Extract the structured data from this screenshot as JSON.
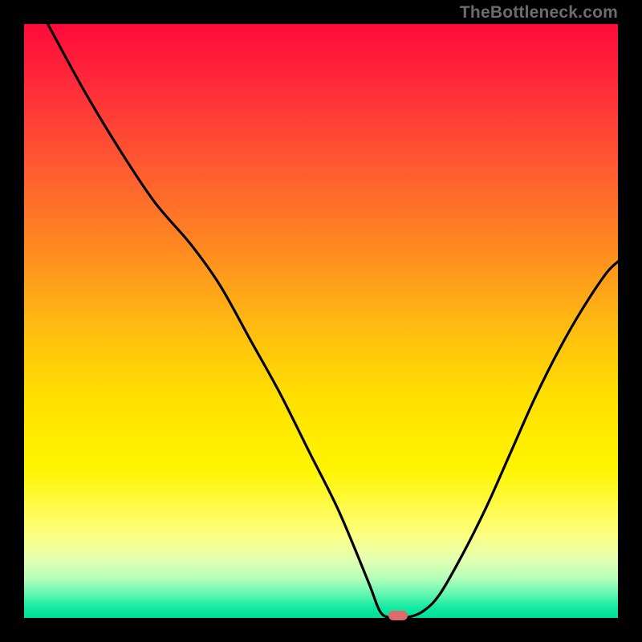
{
  "watermark": "TheBottleneck.com",
  "colors": {
    "frame_bg": "#000000",
    "curve_stroke": "#000000",
    "marker_fill": "#de6b6b",
    "gradient_top": "#ff0a3a",
    "gradient_bottom": "#00e296"
  },
  "chart_data": {
    "type": "line",
    "title": "",
    "xlabel": "",
    "ylabel": "",
    "xlim": [
      0,
      100
    ],
    "ylim": [
      0,
      100
    ],
    "grid": false,
    "legend": false,
    "x": [
      4,
      10,
      16,
      22,
      28,
      33,
      38,
      43,
      48,
      53,
      58,
      60,
      62,
      64,
      67,
      70,
      74,
      78,
      82,
      86,
      90,
      94,
      98,
      100
    ],
    "values": [
      100,
      89,
      79,
      70,
      63,
      56,
      47,
      38,
      28,
      18,
      6,
      1,
      0,
      0,
      1,
      4,
      11,
      19,
      28,
      37,
      45,
      52,
      58,
      60
    ],
    "marker": {
      "x": 63,
      "y": 0
    },
    "notes": "x is horizontal position (% of plot width, left→right); values are heights (% of plot height above bottom). V-shaped bottleneck curve; optimum (~0) near x≈62–64. Values are estimated from pixel positions since there are no axis labels."
  }
}
